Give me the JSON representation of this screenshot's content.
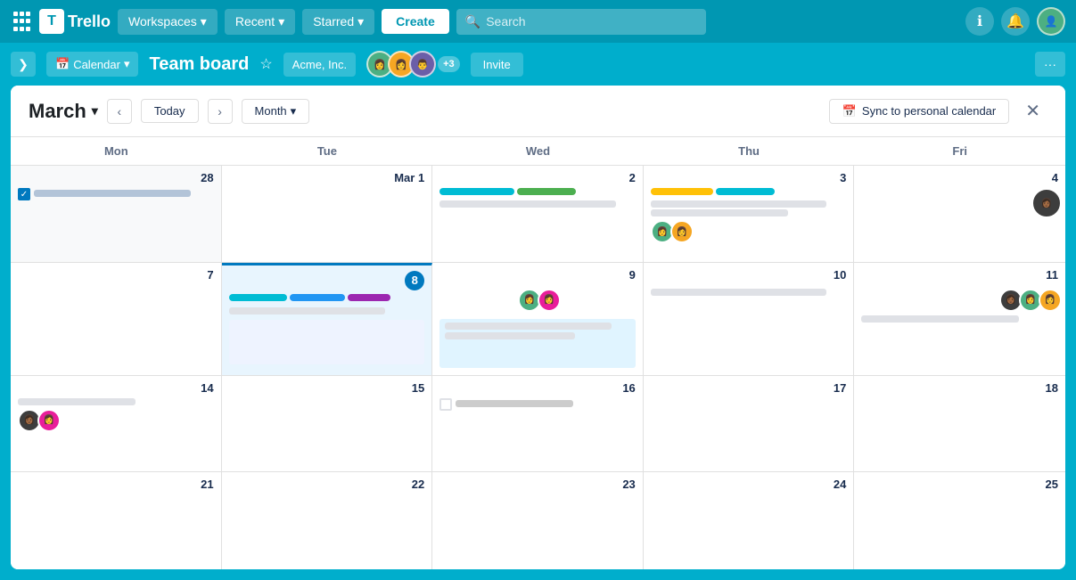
{
  "topnav": {
    "workspaces": "Workspaces",
    "recent": "Recent",
    "starred": "Starred",
    "create": "Create",
    "search_placeholder": "Search"
  },
  "subnav": {
    "view": "Calendar",
    "board_title": "Team board",
    "workspace": "Acme, Inc.",
    "plus_count": "+3",
    "invite": "Invite",
    "more": "···"
  },
  "calendar": {
    "month": "March",
    "today": "Today",
    "view_mode": "Month",
    "sync": "Sync to personal calendar",
    "weekdays": [
      "Mon",
      "Tue",
      "Wed",
      "Thu",
      "Fri"
    ],
    "weeks": [
      {
        "days": [
          {
            "num": "28",
            "sub": "",
            "type": "other-month"
          },
          {
            "num": "Mar 1",
            "sub": "",
            "type": "normal"
          },
          {
            "num": "2",
            "sub": "",
            "type": "normal"
          },
          {
            "num": "3",
            "sub": "",
            "type": "normal"
          },
          {
            "num": "4",
            "sub": "",
            "type": "normal"
          }
        ]
      },
      {
        "days": [
          {
            "num": "7",
            "sub": "",
            "type": "normal"
          },
          {
            "num": "8",
            "sub": "",
            "type": "today"
          },
          {
            "num": "9",
            "sub": "",
            "type": "normal"
          },
          {
            "num": "10",
            "sub": "",
            "type": "normal"
          },
          {
            "num": "11",
            "sub": "",
            "type": "normal"
          }
        ]
      },
      {
        "days": [
          {
            "num": "14",
            "sub": "",
            "type": "normal"
          },
          {
            "num": "15",
            "sub": "",
            "type": "normal"
          },
          {
            "num": "16",
            "sub": "",
            "type": "normal"
          },
          {
            "num": "17",
            "sub": "",
            "type": "normal"
          },
          {
            "num": "18",
            "sub": "",
            "type": "normal"
          }
        ]
      },
      {
        "days": [
          {
            "num": "21",
            "sub": "",
            "type": "normal"
          },
          {
            "num": "22",
            "sub": "",
            "type": "normal"
          },
          {
            "num": "23",
            "sub": "",
            "type": "normal"
          },
          {
            "num": "24",
            "sub": "",
            "type": "normal"
          },
          {
            "num": "25",
            "sub": "",
            "type": "normal"
          }
        ]
      }
    ]
  }
}
